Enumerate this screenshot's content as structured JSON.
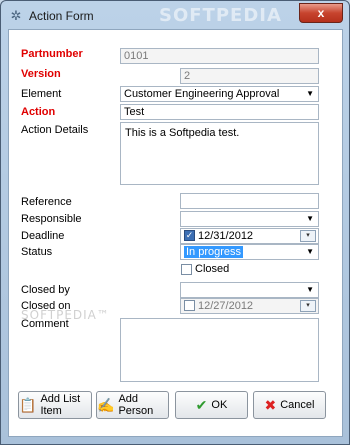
{
  "window": {
    "title": "Action Form",
    "watermark": "SOFTPEDIA",
    "close_label": "x",
    "app_icon": "gear-icon"
  },
  "form": {
    "partnumber": {
      "label": "Partnumber",
      "value": "0101"
    },
    "version": {
      "label": "Version",
      "value": "2"
    },
    "element": {
      "label": "Element",
      "value": "Customer Engineering Approval"
    },
    "action": {
      "label": "Action",
      "value": "Test"
    },
    "action_details": {
      "label": "Action Details",
      "value": "This is a Softpedia test."
    },
    "reference": {
      "label": "Reference",
      "value": ""
    },
    "responsible": {
      "label": "Responsible",
      "value": ""
    },
    "deadline": {
      "label": "Deadline",
      "value": "12/31/2012",
      "checked": true
    },
    "status": {
      "label": "Status",
      "value": "In progress"
    },
    "closed_checkbox": {
      "label": "Closed",
      "checked": false
    },
    "closed_by": {
      "label": "Closed by",
      "value": ""
    },
    "closed_on": {
      "label": "Closed on",
      "value": "12/27/2012",
      "checked": false
    },
    "comment": {
      "label": "Comment",
      "value": ""
    },
    "watermark_faint": "SOFTPEDIA™"
  },
  "buttons": {
    "add_list_item": "Add List Item",
    "add_person": "Add Person",
    "ok": "OK",
    "cancel": "Cancel"
  },
  "colors": {
    "required_label": "#e00000",
    "selection": "#3399ff",
    "window_frame": "#bcd2e8"
  }
}
